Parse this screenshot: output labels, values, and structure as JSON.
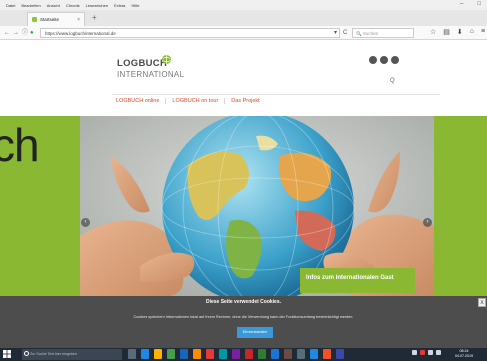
{
  "browser": {
    "menu": [
      "Datei",
      "Bearbeiten",
      "Ansicht",
      "Chronik",
      "Lesezeichen",
      "Extras",
      "Hilfe"
    ],
    "window_controls": [
      "–",
      "□"
    ],
    "tab_title": "Startseite",
    "tab_close": "×",
    "new_tab": "+",
    "url": "https://www.logbuchinternational.de",
    "search_placeholder": "Suchen",
    "nav_icons": {
      "back": "←",
      "forward": "→",
      "reload": "C",
      "home": "⌂"
    }
  },
  "site": {
    "logo_line1": "LOGBUCH",
    "logo_line2": "INTERNATIONAL",
    "social_count": 3,
    "search_icon": "Q",
    "nav": [
      "LOGBUCH online",
      "LOGBUCH on tour",
      "Das Projekt"
    ],
    "hero_behind_text": "ch",
    "carousel_prev": "‹",
    "carousel_next": "›",
    "info_box": "Infos zum internationalen Gast",
    "colors": {
      "brand_green": "#8ab832",
      "nav_red": "#d84a2e",
      "cookie_bg": "#4d4d4d",
      "accept_blue": "#3a9ad9"
    }
  },
  "cookie": {
    "title": "Diese Seite verwendet Cookies.",
    "text": "Cookies speichern Informationen lokal auf Ihrem Rechner, ohne die Verwendung kann der Funktionsumfang beeinträchtigt werden.",
    "accept": "Einverstanden",
    "close": "X"
  },
  "taskbar": {
    "start_icon": "windows-icon",
    "search_placeholder": "Zur Suche Text hier eingeben",
    "app_colors": [
      "#5a6b7c",
      "#1e88e5",
      "#ffb300",
      "#43a047",
      "#1565c0",
      "#fb8c00",
      "#e53935",
      "#0097a7",
      "#7b1fa2",
      "#c62828",
      "#2e7d32",
      "#1976d2",
      "#6d4c41",
      "#546e7a",
      "#1e88e5",
      "#f4511e",
      "#3949ab"
    ],
    "clock_time": "08:24",
    "clock_date": "04.07.2019"
  }
}
